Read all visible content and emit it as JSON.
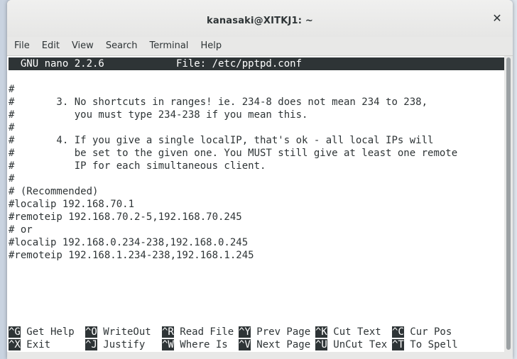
{
  "window": {
    "title": "kanasaki@XITKJ1: ~",
    "close_icon": "close-icon"
  },
  "menubar": [
    "File",
    "Edit",
    "View",
    "Search",
    "Terminal",
    "Help"
  ],
  "nano": {
    "header": "  GNU nano 2.2.6            File: /etc/pptpd.conf",
    "lines": [
      "#",
      "#       3. No shortcuts in ranges! ie. 234-8 does not mean 234 to 238,",
      "#          you must type 234-238 if you mean this.",
      "#",
      "#       4. If you give a single localIP, that's ok - all local IPs will",
      "#          be set to the given one. You MUST still give at least one remote",
      "#          IP for each simultaneous client.",
      "#",
      "# (Recommended)",
      "#localip 192.168.70.1",
      "#remoteip 192.168.70.2-5,192.168.70.245",
      "# or",
      "#localip 192.168.0.234-238,192.168.0.245",
      "#remoteip 192.168.1.234-238,192.168.1.245"
    ],
    "shortcuts_row1": [
      {
        "key": "^G",
        "label": " Get Help"
      },
      {
        "key": "^O",
        "label": " WriteOut"
      },
      {
        "key": "^R",
        "label": " Read File"
      },
      {
        "key": "^Y",
        "label": " Prev Page"
      },
      {
        "key": "^K",
        "label": " Cut Text"
      },
      {
        "key": "^C",
        "label": " Cur Pos"
      }
    ],
    "shortcuts_row2": [
      {
        "key": "^X",
        "label": " Exit"
      },
      {
        "key": "^J",
        "label": " Justify"
      },
      {
        "key": "^W",
        "label": " Where Is"
      },
      {
        "key": "^V",
        "label": " Next Page"
      },
      {
        "key": "^U",
        "label": " UnCut Tex"
      },
      {
        "key": "^T",
        "label": " To Spell"
      }
    ]
  }
}
